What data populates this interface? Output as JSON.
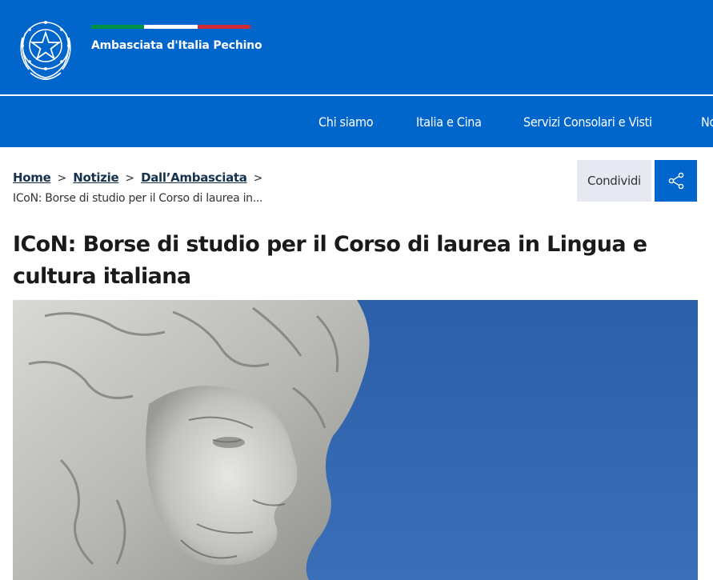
{
  "header": {
    "site_name": "Ambasciata d'Italia Pechino",
    "emblem_icon": "repubblica-italiana-emblem-icon",
    "background_color": "#0066cc",
    "flag_colors": [
      "#009246",
      "#ffffff",
      "#ce2b37"
    ]
  },
  "nav": {
    "items": [
      {
        "label": "Chi siamo"
      },
      {
        "label": "Italia e Cina"
      },
      {
        "label": "Servizi Consolari e Visti"
      },
      {
        "label": "No"
      }
    ]
  },
  "breadcrumb": {
    "items": [
      {
        "label": "Home"
      },
      {
        "label": "Notizie"
      },
      {
        "label": "Dall’Ambasciata"
      }
    ],
    "separator": ">",
    "current": "ICoN: Borse di studio per il Corso di laurea in..."
  },
  "share": {
    "label": "Condividi",
    "icon": "share-icon"
  },
  "article": {
    "title": "ICoN: Borse di studio per il Corso di laurea in Lingua e cultura italiana",
    "hero_image": "marble-statue-head-photo"
  }
}
